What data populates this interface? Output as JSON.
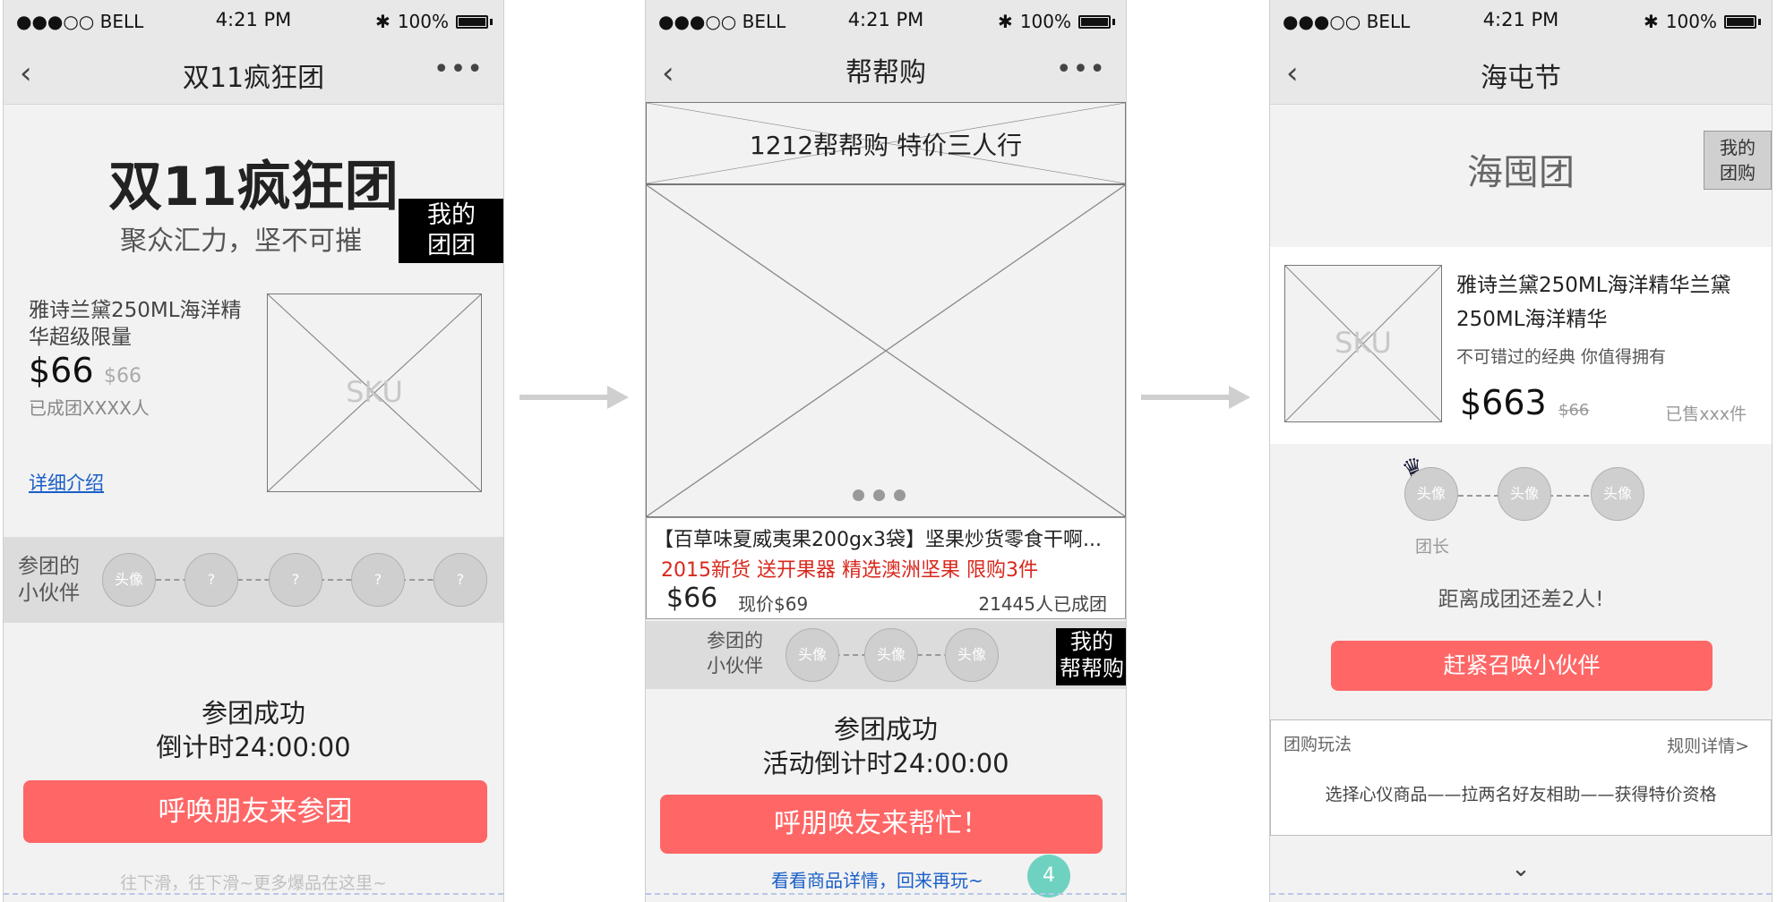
{
  "status": {
    "signal": "●●●○○ BELL",
    "time": "4:21 PM",
    "battery": "100%"
  },
  "screen1": {
    "nav_title": "双11疯狂团",
    "hero_title": "双11疯狂团",
    "slogan": "聚众汇力，坚不可摧",
    "my_group_badge": "我的\n团团",
    "product_name": "雅诗兰黛250ML海洋精华超级限量",
    "price": "$66",
    "old_price": "$66",
    "joined": "已成团XXXX人",
    "detail_link": "详细介绍",
    "sku": "SKU",
    "partners_label": "参团的\n小伙伴",
    "avatars": [
      "头像",
      "?",
      "?",
      "?",
      "?"
    ],
    "success": "参团成功",
    "countdown": "倒计时24:00:00",
    "cta": "呼唤朋友来参团",
    "footer": "往下滑，往下滑~更多爆品在这里~"
  },
  "screen2": {
    "nav_title": "帮帮购",
    "banner": "1212帮帮购 特价三人行",
    "product_name": "【百草味夏威夷果200gx3袋】坚果炒货零食干啊...",
    "promo": "2015新货 送开果器 精选澳洲坚果 限购3件",
    "price": "$66",
    "current_price": "现价$69",
    "joined": "21445人已成团",
    "partners_label": "参团的\n小伙伴",
    "avatars": [
      "头像",
      "头像",
      "头像"
    ],
    "my_badge": "我的\n帮帮购",
    "success": "参团成功",
    "countdown": "活动倒计时24:00:00",
    "cta": "呼朋唤友来帮忙！",
    "detail_link": "看看商品详情，回来再玩~",
    "page_number": "4"
  },
  "screen3": {
    "nav_title": "海屯节",
    "header": "海囤团",
    "my_badge": "我的\n团购",
    "sku": "SKU",
    "product_name": "雅诗兰黛250ML海洋精华兰黛250ML海洋精华",
    "tagline": "不可错过的经典 你值得拥有",
    "price": "$663",
    "old_price": "$66",
    "sold": "已售xxx件",
    "avatars": [
      "头像",
      "头像",
      "头像"
    ],
    "leader_label": "团长",
    "remaining": "距离成团还差2人!",
    "cta": "赶紧召唤小伙伴",
    "rules_title": "团购玩法",
    "rules_link": "规则详情>",
    "rules_text": "选择心仪商品——拉两名好友相助——获得特价资格"
  },
  "colors": {
    "accent": "#ff6666",
    "link": "#1a5fc8",
    "promo": "#d9281e",
    "badge": "#000000",
    "teal": "#6fd2c1"
  }
}
